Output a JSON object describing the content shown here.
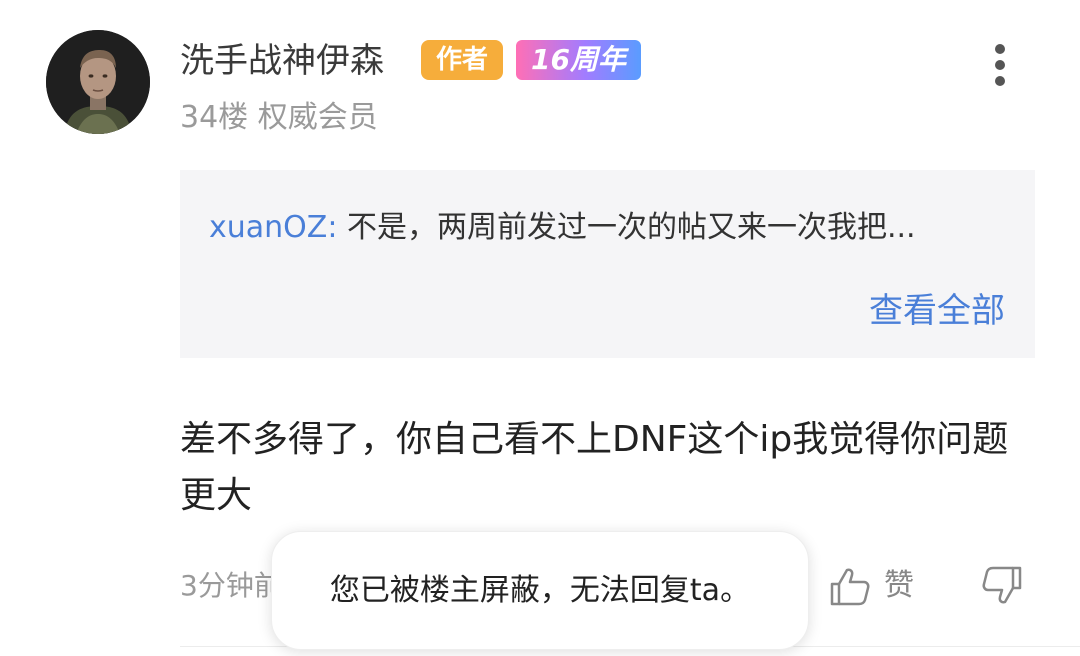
{
  "post": {
    "username": "洗手战神伊森",
    "badge_author": "作者",
    "badge_anniversary": "16周年",
    "floor": "34楼",
    "member_level": "权威会员",
    "more_icon": "more-vertical-icon"
  },
  "quote": {
    "author": "xuanOZ:",
    "text": "不是，两周前发过一次的帖又来一次我把...",
    "view_all": "查看全部"
  },
  "content": {
    "text": "差不多得了，你自己看不上DNF这个ip我觉得你问题更大"
  },
  "footer": {
    "time": "3分钟前",
    "like_label": "赞",
    "icons": [
      "reply-icon",
      "thumbs-up-icon",
      "thumbs-down-icon"
    ]
  },
  "toast": {
    "message": "您已被楼主屏蔽，无法回复ta。"
  },
  "colors": {
    "accent_blue": "#4a7fd8",
    "author_badge": "#f6ad3b",
    "quote_bg": "#f5f5f7"
  }
}
